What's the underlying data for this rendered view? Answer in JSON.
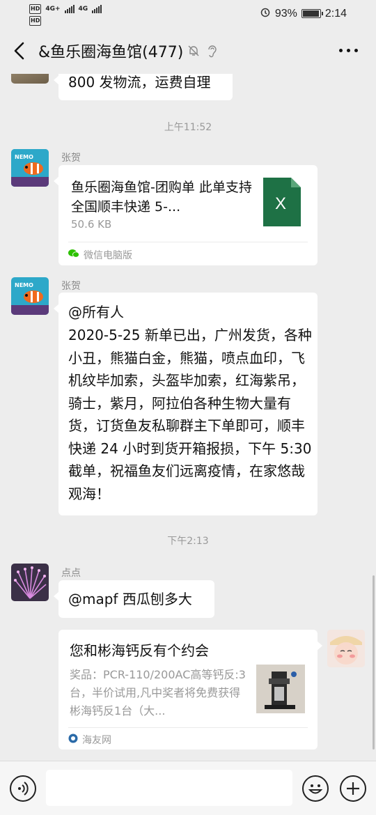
{
  "status_bar": {
    "hd_top": "HD",
    "network_top": "4G+",
    "hd_bottom": "HD",
    "network_bottom": "4G",
    "battery": "93%",
    "time": "2:14"
  },
  "header": {
    "title": "&鱼乐圈海鱼馆(477)"
  },
  "messages": {
    "partial_text": "800 发物流，运费自理",
    "ts1": "上午11:52",
    "file_msg": {
      "sender": "张贺",
      "file_name": "鱼乐圈海鱼馆-团购单 此单支持全国顺丰快递 5-...",
      "file_size": "50.6 KB",
      "file_icon_letter": "X",
      "source": "微信电脑版"
    },
    "text_msg": {
      "sender": "张贺",
      "line1": "@所有人",
      "body": "2020-5-25 新单已出，广州发货，各种小丑，熊猫白金，熊猫，喷点血印，飞机纹毕加索，头盔毕加索，红海紫吊，骑士，紫月，阿拉伯各种生物大量有货，订货鱼友私聊群主下单即可，顺丰快递 24 小时到货开箱报损，下午 5:30 截单，祝福鱼友们远离疫情，在家悠哉观海！"
    },
    "ts2": "下午2:13",
    "reply_msg": {
      "sender": "点点",
      "text": "@mapf  西瓜刨多大"
    },
    "link_card": {
      "title": "您和彬海钙反有个约会",
      "desc": "奖品：PCR-110/200AC高等钙反:3台，半价试用,凡中奖者将免费获得彬海钙反1台（大...",
      "source": "海友网"
    }
  },
  "colors": {
    "background": "#ededed",
    "bubble": "#ffffff",
    "excel_green": "#1e7145",
    "timestamp": "#999999"
  }
}
